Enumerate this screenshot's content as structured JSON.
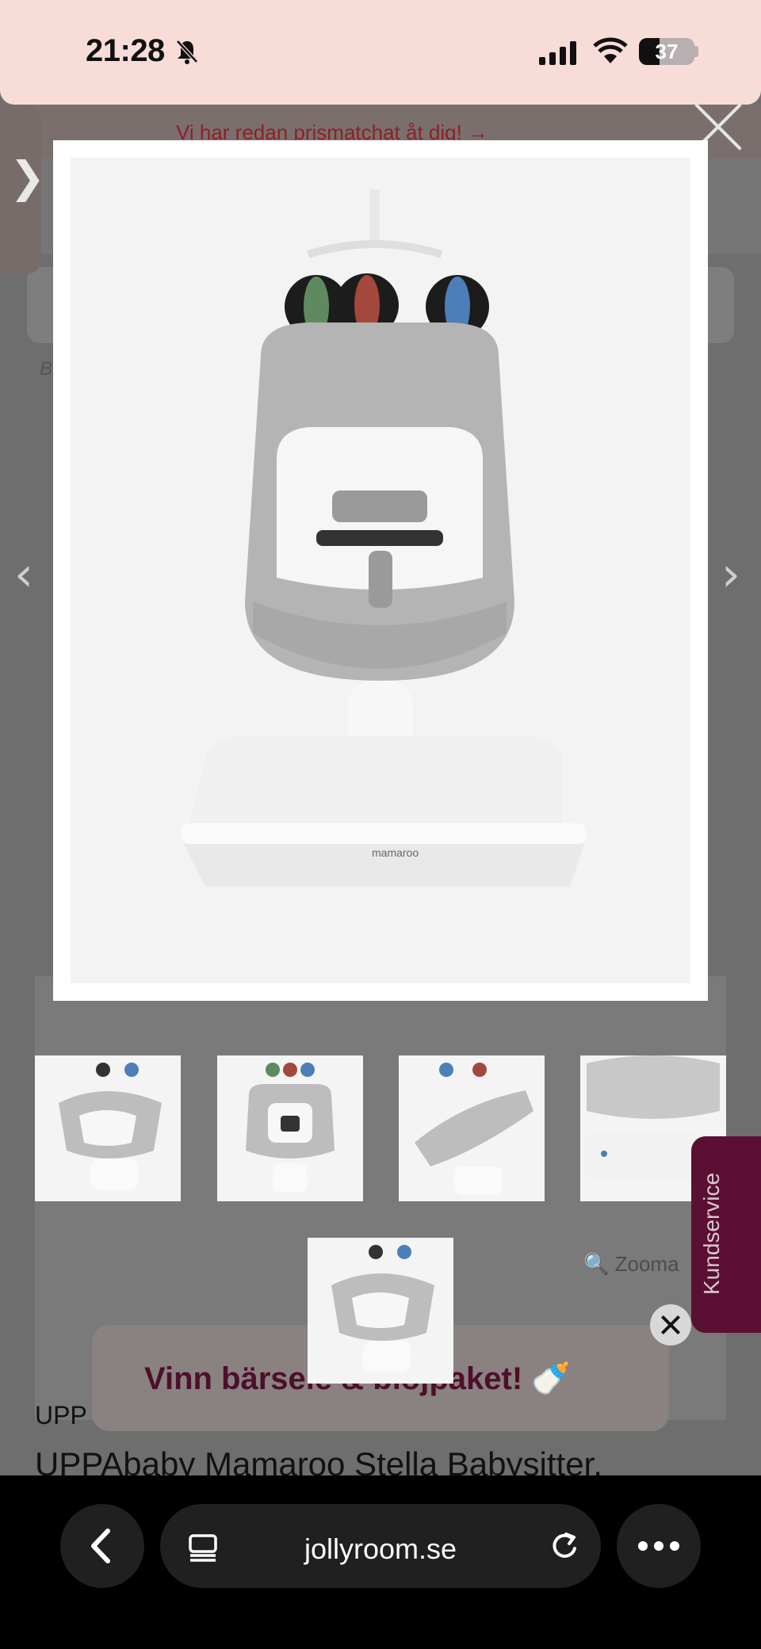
{
  "status_bar": {
    "time": "21:28",
    "battery": "37"
  },
  "page": {
    "promo_banner": "Vi har redan prismatchat åt dig! →",
    "breadcrumb_stub": "B",
    "zoom_hint": "Zooma",
    "brand": "UPP",
    "product_title": "UPPAbaby Mamaroo Stella Babysitter,"
  },
  "gallery": {
    "side_tab_glyph": "❯",
    "prev_arrow": "‹",
    "next_arrow": "›",
    "base_label": "mamaroo",
    "thumbnails": 5
  },
  "kundservice_label": "Kundservice",
  "promo_card": {
    "text": "Vinn bärsele & blöjpaket! 🍼"
  },
  "browser": {
    "url": "jollyroom.se"
  },
  "colors": {
    "accent": "#5b1033",
    "status_bg": "#f8dcd7",
    "promo_text": "#8e1f2a"
  }
}
